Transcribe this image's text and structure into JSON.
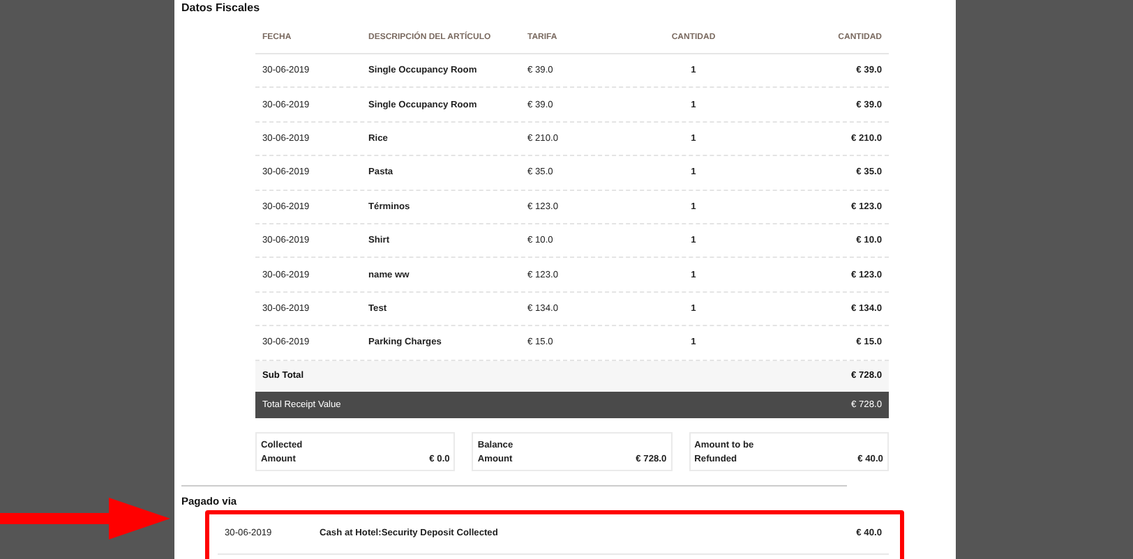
{
  "section_title": "Datos Fiscales",
  "table": {
    "columns": [
      "FECHA",
      "DESCRIPCIÓN DEL ARTÍCULO",
      "TARIFA",
      "CANTIDAD",
      "CANTIDAD"
    ],
    "rows": [
      {
        "date": "30-06-2019",
        "description": "Single Occupancy Room",
        "rate": "€ 39.0",
        "quantity": "1",
        "amount": "€ 39.0"
      },
      {
        "date": "30-06-2019",
        "description": "Single Occupancy Room",
        "rate": "€ 39.0",
        "quantity": "1",
        "amount": "€ 39.0"
      },
      {
        "date": "30-06-2019",
        "description": "Rice",
        "rate": "€ 210.0",
        "quantity": "1",
        "amount": "€ 210.0"
      },
      {
        "date": "30-06-2019",
        "description": "Pasta",
        "rate": "€ 35.0",
        "quantity": "1",
        "amount": "€ 35.0"
      },
      {
        "date": "30-06-2019",
        "description": "Términos",
        "rate": "€ 123.0",
        "quantity": "1",
        "amount": "€ 123.0"
      },
      {
        "date": "30-06-2019",
        "description": "Shirt",
        "rate": "€ 10.0",
        "quantity": "1",
        "amount": "€ 10.0"
      },
      {
        "date": "30-06-2019",
        "description": "name ww",
        "rate": "€ 123.0",
        "quantity": "1",
        "amount": "€ 123.0"
      },
      {
        "date": "30-06-2019",
        "description": "Test",
        "rate": "€ 134.0",
        "quantity": "1",
        "amount": "€ 134.0"
      },
      {
        "date": "30-06-2019",
        "description": "Parking Charges",
        "rate": "€ 15.0",
        "quantity": "1",
        "amount": "€ 15.0"
      }
    ],
    "subtotal": {
      "label": "Sub Total",
      "value": "€ 728.0"
    },
    "total": {
      "label": "Total Receipt Value",
      "value": "€ 728.0"
    }
  },
  "summary": [
    {
      "label_line1": "Collected",
      "label_line2": "Amount",
      "value": "€ 0.0"
    },
    {
      "label_line1": "Balance",
      "label_line2": "Amount",
      "value": "€ 728.0"
    },
    {
      "label_line1": "Amount to be",
      "label_line2": "Refunded",
      "value": "€ 40.0"
    }
  ],
  "payments_title": "Pagado via",
  "payments": [
    {
      "date": "30-06-2019",
      "method": "Cash at Hotel:Security Deposit Collected",
      "amount": "€ 40.0"
    }
  ]
}
